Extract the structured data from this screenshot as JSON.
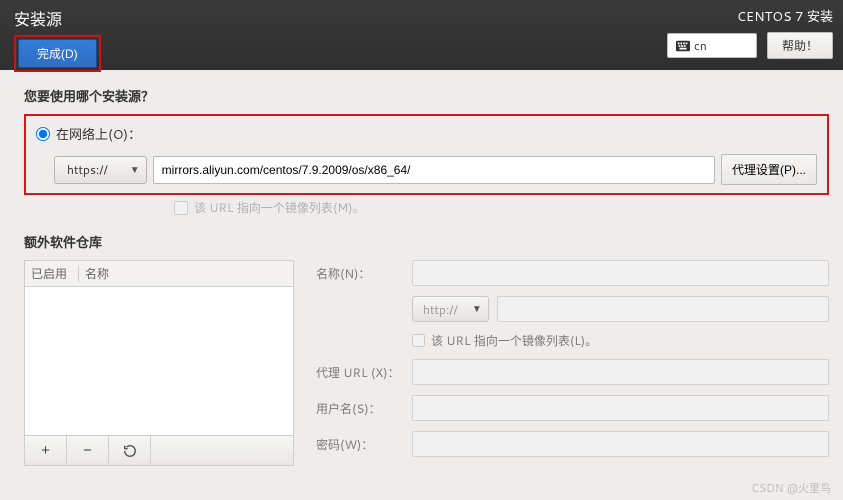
{
  "header": {
    "title": "安装源",
    "done_label": "完成(D)",
    "install_label": "CENTOS 7 安装",
    "kbd_layout": "cn",
    "help_label": "帮助！"
  },
  "source": {
    "question": "您要使用哪个安装源？",
    "radio_network_label": "在网络上(O)：",
    "protocol_selected": "https://",
    "url_value": "mirrors.aliyun.com/centos/7.9.2009/os/x86_64/",
    "proxy_label": "代理设置(P)...",
    "mirror_checkbox_label": "该 URL 指向一个镜像列表(M)。"
  },
  "extra": {
    "section_title": "额外软件仓库",
    "col_enabled": "已启用",
    "col_name": "名称",
    "form": {
      "name_label": "名称(N)：",
      "protocol_selected": "http://",
      "mirror_label": "该 URL 指向一个镜像列表(L)。",
      "proxy_url_label": "代理 URL (X)：",
      "user_label": "用户名(S)：",
      "pass_label": "密码(W)："
    },
    "buttons": {
      "add": "+",
      "remove": "−",
      "refresh": "↻"
    }
  },
  "watermark": "CSDN @火里鸟"
}
